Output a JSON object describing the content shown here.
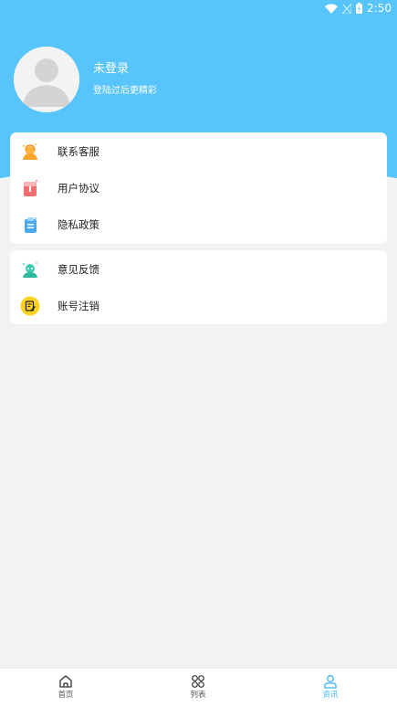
{
  "status_bar": {
    "time": "2:50",
    "icons": [
      "wifi-icon",
      "signal-icon",
      "battery-icon"
    ]
  },
  "profile": {
    "title": "未登录",
    "subtitle": "登陆过后更精彩"
  },
  "menu_groups": [
    {
      "items": [
        {
          "label": "联系客服",
          "icon": "customer-service-icon"
        },
        {
          "label": "用户协议",
          "icon": "user-agreement-icon"
        },
        {
          "label": "隐私政策",
          "icon": "privacy-policy-icon"
        }
      ]
    },
    {
      "items": [
        {
          "label": "意见反馈",
          "icon": "feedback-icon"
        },
        {
          "label": "账号注销",
          "icon": "account-cancel-icon"
        }
      ]
    }
  ],
  "bottom_nav": {
    "items": [
      {
        "label": "首页",
        "icon": "home-icon",
        "active": false
      },
      {
        "label": "列表",
        "icon": "grid-icon",
        "active": false
      },
      {
        "label": "资讯",
        "icon": "person-icon",
        "active": true
      }
    ]
  },
  "colors": {
    "accent": "#57c4fb",
    "active_nav": "#3fb5f2",
    "background": "#f2f2f2"
  }
}
